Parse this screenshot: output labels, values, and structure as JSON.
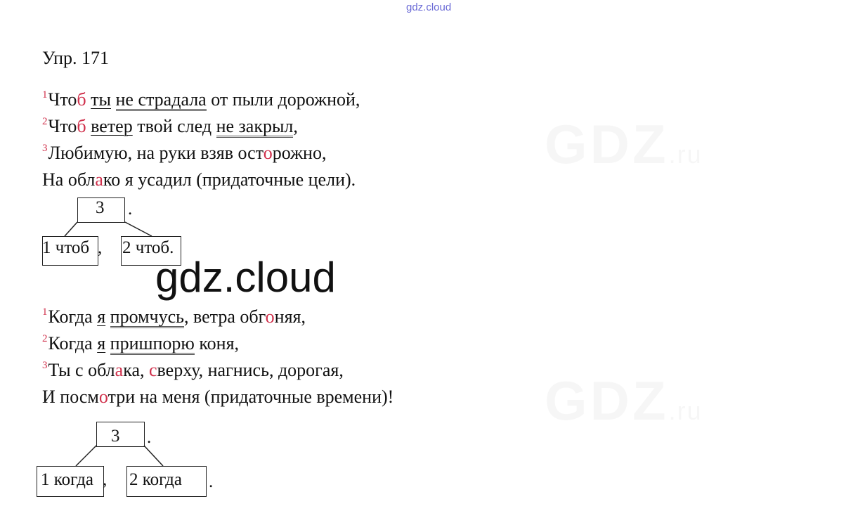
{
  "watermark_top": "gdz.cloud",
  "watermark_center": "gdz.cloud",
  "bg_watermark": {
    "main": "GDZ",
    "suffix": ".ru"
  },
  "title": "Упр. 171",
  "poem1": {
    "l1": {
      "n": "1",
      "a": "Что",
      "b": "б",
      "c": " ",
      "subj": "ты",
      "d": " ",
      "pred": "не страдала",
      "e": " от пыли дорожной,"
    },
    "l2": {
      "n": "2",
      "a": "Что",
      "b": "б",
      "c": " ",
      "subj": "ветер",
      "d": " твой след ",
      "pred": "не закрыл",
      "e": ","
    },
    "l3": {
      "n": "3",
      "a": "Любимую, на руки взяв ост",
      "b": "о",
      "c": "рожно,"
    },
    "l4": {
      "a": "На обл",
      "b": "а",
      "c": "ко я усадил (придаточные цели)."
    }
  },
  "scheme1": {
    "main": "3",
    "dot": ".",
    "left": "1 чтоб",
    "comma": ",",
    "right": "2 чтоб."
  },
  "poem2": {
    "l1": {
      "n": "1",
      "a": "Когда ",
      "subj": "я",
      "b": " ",
      "pred": "промчусь",
      "c": ", ветра обг",
      "d": "о",
      "e": "няя,"
    },
    "l2": {
      "n": "2",
      "a": "Когда ",
      "subj": "я",
      "b": " ",
      "pred": "пришпорю",
      "c": " коня,"
    },
    "l3": {
      "n": "3",
      "a": "Ты с обл",
      "b": "а",
      "c": "ка, ",
      "d": "с",
      "e": "верху, нагнись, дорогая,"
    },
    "l4": {
      "a": "И посм",
      "b": "о",
      "c": "три на меня (придаточные времени)!"
    }
  },
  "scheme2": {
    "main": "3",
    "dot": ".",
    "left": "1 когда",
    "comma": ",",
    "right": "2 когда",
    "end_dot": "."
  }
}
